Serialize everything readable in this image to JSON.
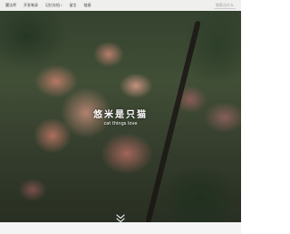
{
  "nav": {
    "items": [
      {
        "label": "魔法师",
        "has_caret": false
      },
      {
        "label": "开发笔录",
        "has_caret": false
      },
      {
        "label": "记忆存档",
        "has_caret": true
      },
      {
        "label": "留言",
        "has_caret": false
      },
      {
        "label": "链接",
        "has_caret": false
      }
    ],
    "caret_glyph": "▾",
    "search_placeholder": "搜索点什么"
  },
  "hero": {
    "title": "悠米是只猫",
    "subtitle": "cat things love"
  }
}
